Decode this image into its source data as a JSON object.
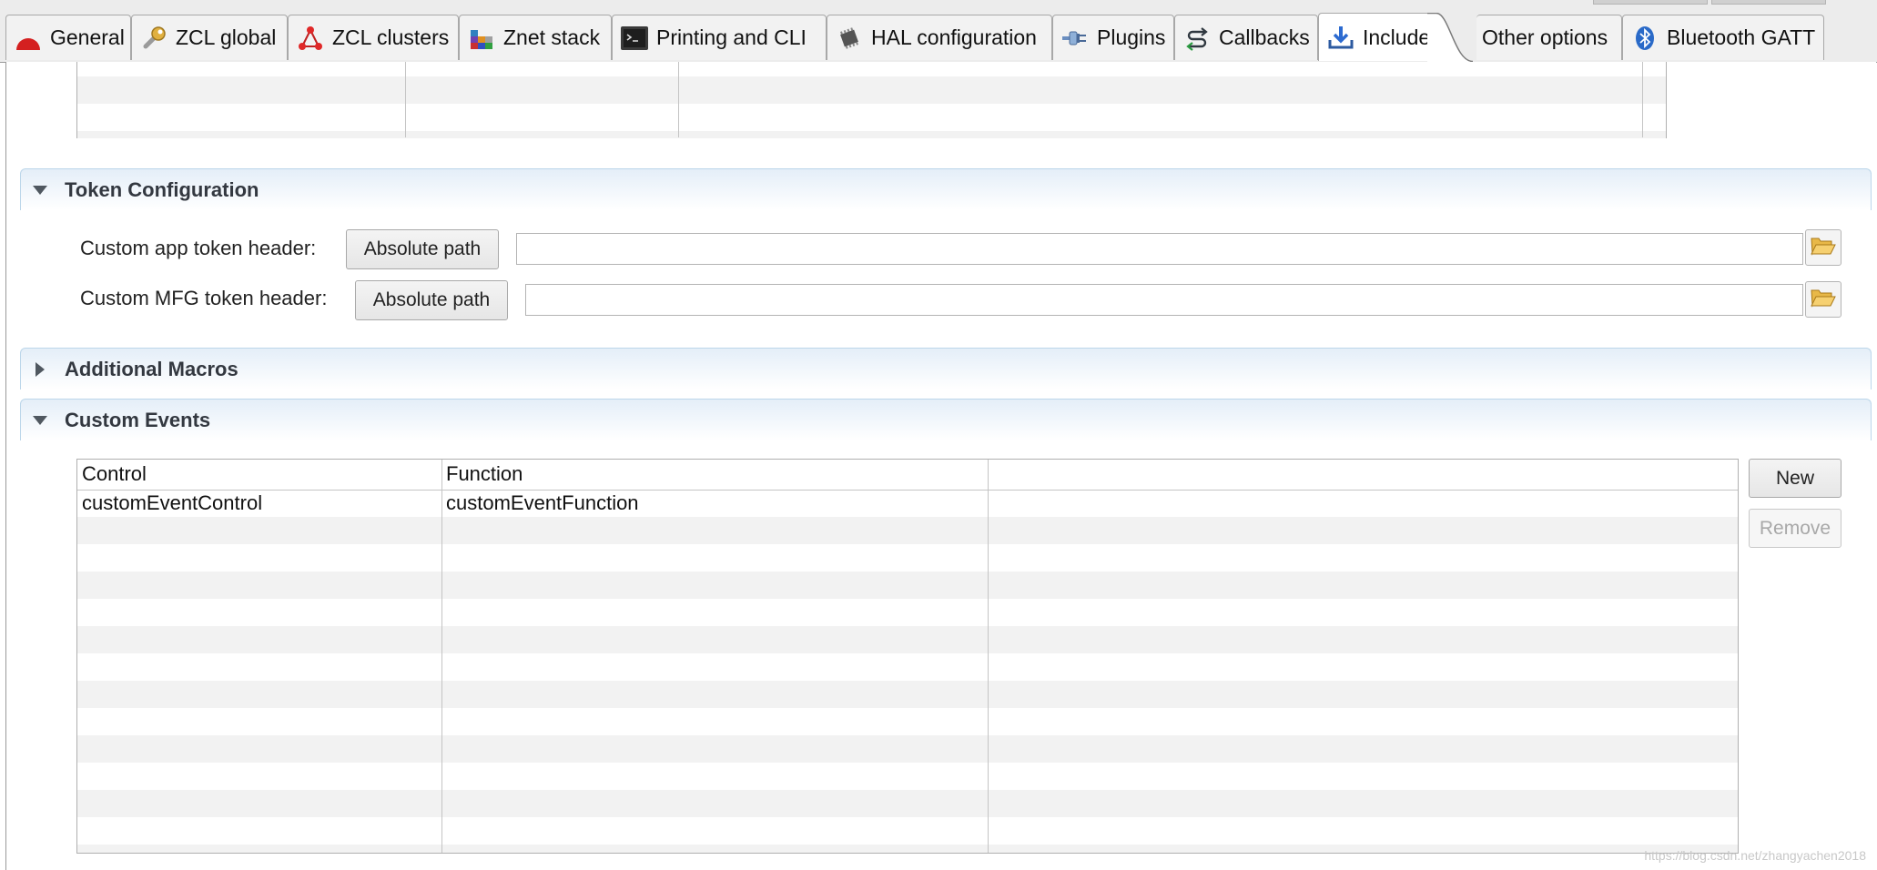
{
  "tabs": [
    {
      "label": "General",
      "icon": "red-dome-icon"
    },
    {
      "label": "ZCL global",
      "icon": "wrench-icon"
    },
    {
      "label": "ZCL clusters",
      "icon": "cluster-nodes-icon"
    },
    {
      "label": "Znet stack",
      "icon": "stack-blocks-icon"
    },
    {
      "label": "Printing and CLI",
      "icon": "terminal-icon"
    },
    {
      "label": "HAL configuration",
      "icon": "chip-icon"
    },
    {
      "label": "Plugins",
      "icon": "plug-icon"
    },
    {
      "label": "Callbacks",
      "icon": "callback-arrows-icon"
    },
    {
      "label": "Includes",
      "icon": "download-tray-icon",
      "active": true
    },
    {
      "label": "Other options",
      "icon": ""
    },
    {
      "label": "Bluetooth GATT",
      "icon": "bluetooth-icon"
    }
  ],
  "token_config": {
    "title": "Token Configuration",
    "app_label": "Custom app token header:",
    "app_button": "Absolute path",
    "app_value": "",
    "mfg_label": "Custom MFG token header:",
    "mfg_button": "Absolute path",
    "mfg_value": ""
  },
  "additional_macros": {
    "title": "Additional Macros"
  },
  "custom_events": {
    "title": "Custom Events",
    "columns": [
      "Control",
      "Function"
    ],
    "rows": [
      {
        "control": "customEventControl",
        "function": "customEventFunction"
      }
    ],
    "new_button": "New",
    "remove_button": "Remove"
  },
  "watermark": "https://blog.csdn.net/zhangyachen2018",
  "colors": {
    "section_border": "#bcd6ea",
    "section_gradient_top": "#e4eef8",
    "row_stripe": "#f2f2f2"
  }
}
